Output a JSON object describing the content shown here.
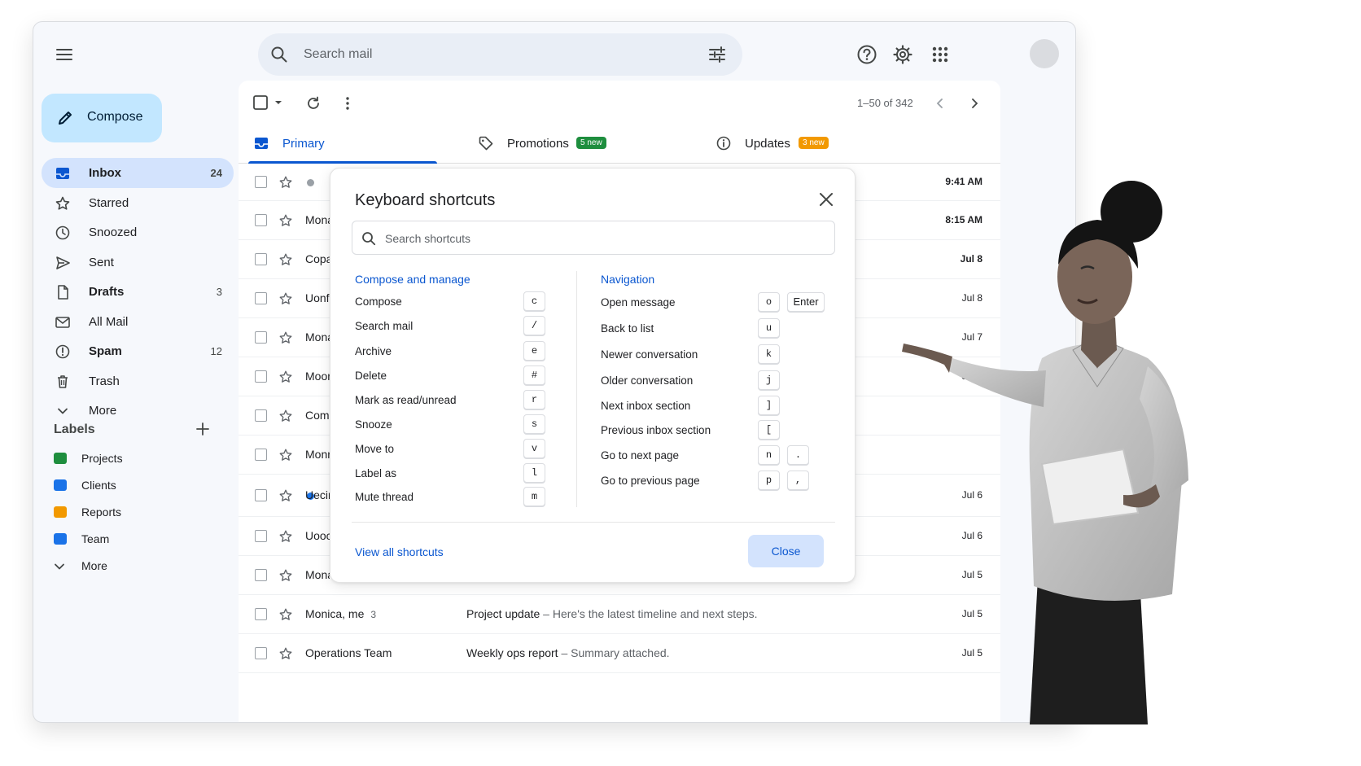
{
  "app": {
    "search_placeholder": "Search mail",
    "compose_label": "Compose"
  },
  "nav": [
    {
      "label": "Inbox",
      "count": "24",
      "icon": "inbox-icon"
    },
    {
      "label": "Starred",
      "count": "",
      "icon": "star-icon"
    },
    {
      "label": "Snoozed",
      "count": "",
      "icon": "clock-icon"
    },
    {
      "label": "Sent",
      "count": "",
      "icon": "send-icon"
    },
    {
      "label": "Drafts",
      "count": "3",
      "icon": "draft-icon"
    },
    {
      "label": "All Mail",
      "count": "",
      "icon": "mail-icon"
    },
    {
      "label": "Spam",
      "count": "12",
      "icon": "spam-icon"
    },
    {
      "label": "Trash",
      "count": "",
      "icon": "trash-icon"
    },
    {
      "label": "More",
      "count": "",
      "icon": "chevron-down-icon"
    }
  ],
  "labels": {
    "title": "Labels",
    "items": [
      {
        "label": "Projects",
        "color": "#1e8e3e"
      },
      {
        "label": "Clients",
        "color": "#1a73e8"
      },
      {
        "label": "Reports",
        "color": "#f29900"
      },
      {
        "label": "Team",
        "color": "#1a73e8"
      }
    ],
    "more": "More"
  },
  "toolbar": {
    "pager": "1–50 of 342"
  },
  "tabs": [
    {
      "label": "Primary",
      "badge": "",
      "icon": "inbox-icon"
    },
    {
      "label": "Promotions",
      "badge": "5 new",
      "badge_color": "#1e8e3e",
      "icon": "tag-icon"
    },
    {
      "label": "Updates",
      "badge": "3 new",
      "badge_color": "#f29900",
      "icon": "info-icon"
    }
  ],
  "emails": [
    {
      "sender": "",
      "date": "9:41 AM",
      "subject": "",
      "snippet": "",
      "unread_dot": "grey"
    },
    {
      "sender": "Mona",
      "date": "8:15 AM"
    },
    {
      "sender": "Copa",
      "date": "Jul 8"
    },
    {
      "sender": "Uonf",
      "date": "Jul 8"
    },
    {
      "sender": "Mona",
      "date": "Jul 7"
    },
    {
      "sender": "Moor",
      "date": "Jul 7"
    },
    {
      "sender": "Com",
      "date": ""
    },
    {
      "sender": "Monr",
      "date": ""
    },
    {
      "sender": "Uecir",
      "date": "Jul 6",
      "unread_dot": "blue"
    },
    {
      "sender": "Uooc",
      "date": "Jul 6"
    },
    {
      "sender": "Mona",
      "date": "Jul 5"
    },
    {
      "sender": "Monica, me",
      "thread_count": "3",
      "subject": "Project update",
      "snippet": " – Here's the latest timeline and next steps.",
      "date": "Jul 5"
    },
    {
      "sender": "Operations Team",
      "subject": "Weekly ops report",
      "snippet": " – Summary attached.",
      "date": "Jul 5"
    }
  ],
  "dialog": {
    "title": "Keyboard shortcuts",
    "search_placeholder": "Search shortcuts",
    "left_heading": "Compose and manage",
    "right_heading": "Navigation",
    "left": [
      {
        "label": "Compose",
        "keys": [
          "c"
        ]
      },
      {
        "label": "Search mail",
        "keys": [
          "/"
        ]
      },
      {
        "label": "Archive",
        "keys": [
          "e"
        ]
      },
      {
        "label": "Delete",
        "keys": [
          "#"
        ]
      },
      {
        "label": "Mark as read/unread",
        "keys": [
          "r"
        ]
      },
      {
        "label": "Snooze",
        "keys": [
          "s"
        ]
      },
      {
        "label": "Move to",
        "keys": [
          "v"
        ]
      },
      {
        "label": "Label as",
        "keys": [
          "l"
        ]
      },
      {
        "label": "Mute thread",
        "keys": [
          "m"
        ]
      }
    ],
    "right": [
      {
        "label": "Open message",
        "keys": [
          "o",
          "Enter"
        ]
      },
      {
        "label": "Back to list",
        "keys": [
          "u"
        ]
      },
      {
        "label": "Newer conversation",
        "keys": [
          "k"
        ]
      },
      {
        "label": "Older conversation",
        "keys": [
          "j"
        ]
      },
      {
        "label": "Next inbox section",
        "keys": [
          "]"
        ]
      },
      {
        "label": "Previous inbox section",
        "keys": [
          "["
        ]
      },
      {
        "label": "Go to next page",
        "keys": [
          "n",
          "."
        ]
      },
      {
        "label": "Go to previous page",
        "keys": [
          "p",
          ","
        ]
      }
    ],
    "view_all": "View all shortcuts",
    "close": "Close"
  }
}
